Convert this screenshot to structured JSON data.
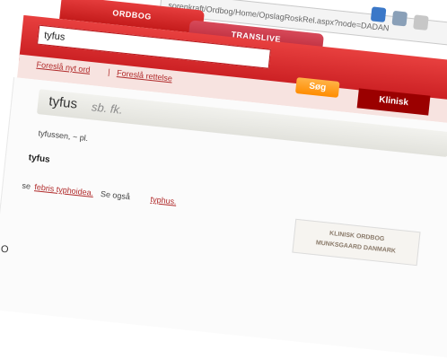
{
  "browser": {
    "url": "sorenkraft/Ordbog/Home/OpslagRoskRel.aspx?node=DADAN"
  },
  "tabs": [
    {
      "label": "ORDBOG"
    },
    {
      "label": "TRANSLIVE"
    }
  ],
  "search": {
    "value": "tyfus",
    "button_label": "Søg",
    "mode_button_label": "Klinisk"
  },
  "suggestions": {
    "link1": "Foreslå nyt ord",
    "separator": "|",
    "link2": "Foreslå rettelse"
  },
  "entry": {
    "headword": "tyfus",
    "grammar": "sb. fk.",
    "inflection": "tyfussen, ~ pl.",
    "definition_head": "tyfus",
    "see_label": "se",
    "see_link": "febris typhoidea.",
    "see_also_label": "Se også",
    "see_also_link": "typhus."
  },
  "promo": {
    "line1": "KLINISK ORDBOG",
    "line2": "MUNKSGAARD DANMARK"
  },
  "footer": {
    "fragment": "O"
  },
  "colors": {
    "primary_red": "#d0272a",
    "search_orange": "#ff8c00",
    "dark_red": "#9b0000"
  }
}
